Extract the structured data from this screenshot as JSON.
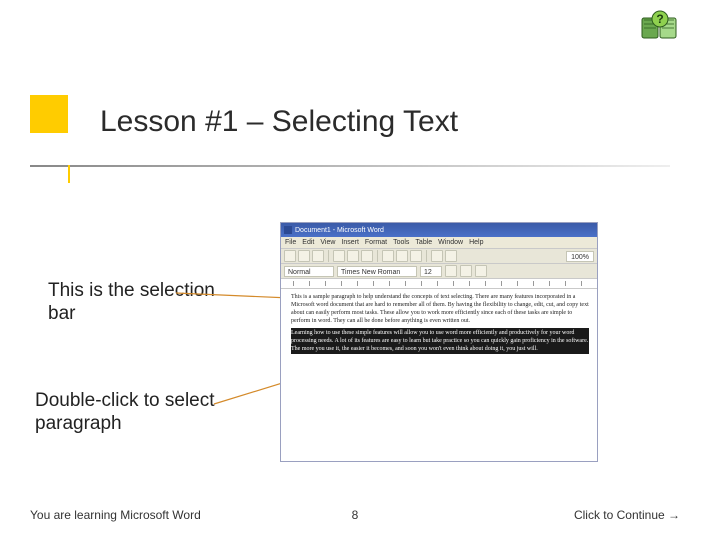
{
  "title": "Lesson #1 – Selecting Text",
  "callouts": {
    "selection_bar": "This is the selection bar",
    "double_click": "Double-click to select paragraph"
  },
  "word": {
    "titlebar": "Document1 - Microsoft Word",
    "menus": [
      "File",
      "Edit",
      "View",
      "Insert",
      "Format",
      "Tools",
      "Table",
      "Window",
      "Help"
    ],
    "zoom": "100%",
    "style_selector": "Normal",
    "font_selector": "Times New Roman",
    "font_size": "12",
    "paragraphs": {
      "p1": "This is a sample paragraph to help understand the concepts of text selecting.  There are many features incorporated in a Microsoft word document that are hard to remember all of them.  By having the flexibility to change, edit, cut, and copy text about can easily perform most tasks.  These allow you to work more efficiently since each of these tasks are simple to perform in word.  They can all be done before anything is even written out.",
      "p2": "Learning how to use these simple features will allow you to use word more efficiently and productively for your word processing needs.  A lot of its features are easy to learn but take practice so you can quickly gain proficiency in the software.  The more you use it, the easier it becomes, and soon you won't even think about doing it, you just will."
    }
  },
  "footer": {
    "left": "You are learning Microsoft Word",
    "page": "8",
    "right": "Click to Continue →"
  }
}
